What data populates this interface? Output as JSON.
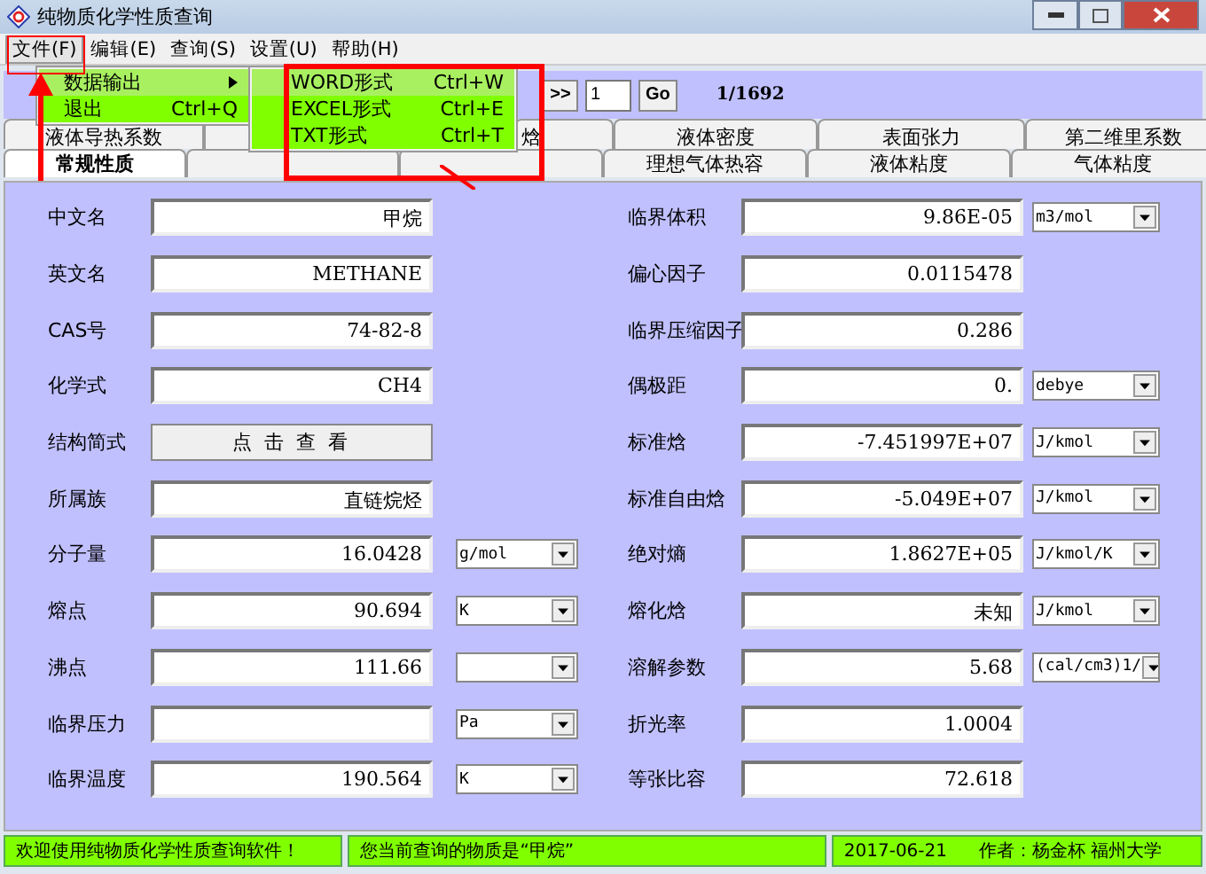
{
  "window": {
    "title": "纯物质化学性质查询"
  },
  "menubar": [
    {
      "label": "文件(F)",
      "selected": true
    },
    {
      "label": "编辑(E)",
      "selected": false
    },
    {
      "label": "查询(S)",
      "selected": false
    },
    {
      "label": "设置(U)",
      "selected": false
    },
    {
      "label": "帮助(H)",
      "selected": false
    }
  ],
  "file_menu": [
    {
      "label": "数据输出",
      "submenu": true,
      "selected": true
    },
    {
      "label": "退出",
      "shortcut": "Ctrl+Q",
      "submenu": false,
      "selected": false
    }
  ],
  "export_submenu": [
    {
      "label": "WORD形式",
      "shortcut": "Ctrl+W",
      "selected": true
    },
    {
      "label": "EXCEL形式",
      "shortcut": "Ctrl+E",
      "selected": false
    },
    {
      "label": "TXT形式",
      "shortcut": "Ctrl+T",
      "selected": false
    }
  ],
  "navigator": {
    "next_last": ">>",
    "record": "1",
    "go": "Go",
    "count": "1/1692"
  },
  "tabs_back": [
    {
      "label": "液体导热系数",
      "selected": false
    },
    {
      "label": "焓",
      "selected": false
    },
    {
      "label": "液体密度",
      "selected": false
    },
    {
      "label": "表面张力",
      "selected": false
    },
    {
      "label": "第二维里系数",
      "selected": false
    }
  ],
  "tabs_front": [
    {
      "label": "常规性质",
      "selected": true
    },
    {
      "label": "理想气体热容",
      "selected": false
    },
    {
      "label": "液体粘度",
      "selected": false
    },
    {
      "label": "气体粘度",
      "selected": false
    }
  ],
  "left_fields": [
    {
      "kind": "field",
      "label": "中文名",
      "value": "甲烷"
    },
    {
      "kind": "field",
      "label": "英文名",
      "value": "METHANE"
    },
    {
      "kind": "field",
      "label": "CAS号",
      "value": "74-82-8"
    },
    {
      "kind": "field",
      "label": "化学式",
      "value": "CH4"
    },
    {
      "kind": "button",
      "label": "结构简式",
      "value": "点 击 查 看"
    },
    {
      "kind": "field",
      "label": "所属族",
      "value": "直链烷烃"
    },
    {
      "kind": "field",
      "label": "分子量",
      "value": "16.0428",
      "dropdown": true,
      "unit": "g/mol"
    },
    {
      "kind": "field",
      "label": "熔点",
      "value": "90.694",
      "dropdown": true,
      "unit": "K"
    },
    {
      "kind": "field",
      "label": "沸点",
      "value": "111.66",
      "dropdown": true
    },
    {
      "kind": "field",
      "label": "临界压力",
      "dropdown": true,
      "unit": "Pa"
    },
    {
      "kind": "field",
      "label": "临界温度",
      "value": "190.564",
      "dropdown": true,
      "unit": "K"
    }
  ],
  "right_fields": [
    {
      "kind": "field",
      "label": "临界体积",
      "value": "9.86E-05",
      "dropdown": true,
      "unit": "m3/mol"
    },
    {
      "kind": "field",
      "label": "偏心因子",
      "value": "0.0115478",
      "dropdown": false
    },
    {
      "kind": "field",
      "label": "临界压缩因子",
      "value": "0.286",
      "dropdown": false
    },
    {
      "kind": "field",
      "label": "偶极距",
      "value": "0.",
      "dropdown": true,
      "unit": "debye"
    },
    {
      "kind": "field",
      "label": "标准焓",
      "value": "-7.451997E+07",
      "dropdown": true,
      "unit": "J/kmol"
    },
    {
      "kind": "field",
      "label": "标准自由焓",
      "value": "-5.049E+07",
      "dropdown": true,
      "unit": "J/kmol"
    },
    {
      "kind": "field",
      "label": "绝对熵",
      "value": "1.8627E+05",
      "dropdown": true,
      "unit": "J/kmol/K"
    },
    {
      "kind": "field",
      "label": "熔化焓",
      "value": "未知",
      "dropdown": true,
      "unit": "J/kmol"
    },
    {
      "kind": "field",
      "label": "溶解参数",
      "value": "5.68",
      "dropdown": true,
      "unit": "(cal/cm3)1/"
    },
    {
      "kind": "field",
      "label": "折光率",
      "value": "1.0004",
      "dropdown": false
    },
    {
      "kind": "field",
      "label": "等张比容",
      "value": "72.618",
      "dropdown": false
    }
  ],
  "status_bar": [
    "欢迎使用纯物质化学性质查询软件！",
    "您当前查询的物质是“甲烷”",
    "2017-06-21",
    "作者：杨金杯   福州大学"
  ]
}
